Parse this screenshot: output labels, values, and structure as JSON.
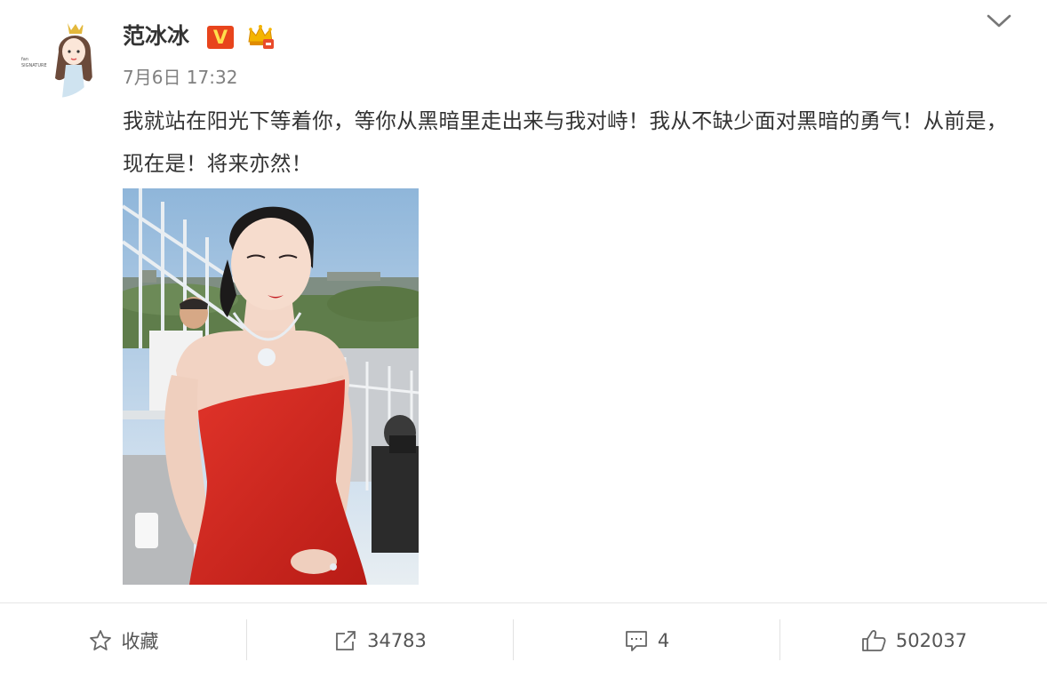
{
  "user": {
    "name": "范冰冰",
    "verified_badge": "V"
  },
  "post": {
    "timestamp": "7月6日 17:32",
    "text": "我就站在阳光下等着你，等你从黑暗里走出来与我对峙！我从不缺少面对黑暗的勇气！从前是，现在是！将来亦然！"
  },
  "toolbar": {
    "favorite_label": "收藏",
    "repost_count": "34783",
    "comment_count": "4",
    "like_count": "502037"
  },
  "colors": {
    "verified_badge_bg": "#e8441c",
    "verified_badge_text": "#ffdf4d",
    "dress_red": "#d5281d",
    "icon_gray": "#666666"
  },
  "icons": [
    "crown-icon",
    "chevron-down-icon",
    "star-icon",
    "repost-icon",
    "comment-icon",
    "thumbs-up-icon"
  ]
}
